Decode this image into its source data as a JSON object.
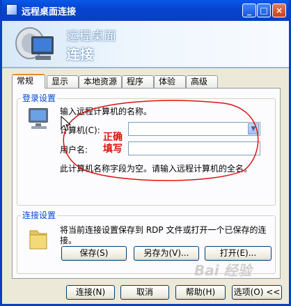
{
  "window": {
    "title": "远程桌面连接"
  },
  "banner": {
    "line1": "远程桌面",
    "line2": "连接"
  },
  "tabs": [
    "常规",
    "显示",
    "本地资源",
    "程序",
    "体验",
    "高级"
  ],
  "login": {
    "group_label": "登录设置",
    "instruction": "输入远程计算机的名称。",
    "computer_label": "计算机(C):",
    "computer_value": "",
    "username_label": "用户名:",
    "username_value": "",
    "note": "此计算机名称字段为空。请输入远程计算机的全名。"
  },
  "connection": {
    "group_label": "连接设置",
    "description_line1": "将当前连接设置保存到 RDP 文件或打开一个已保存的连",
    "description_line2": "接。",
    "save_label": "保存(S)",
    "save_as_label": "另存为(V)...",
    "open_label": "打开(E)..."
  },
  "footer": {
    "connect_label": "连接(N)",
    "cancel_label": "取消",
    "help_label": "帮助(H)",
    "options_label": "选项(O) <<"
  },
  "annotation": {
    "line1": "正确",
    "line2": "填写"
  },
  "watermark": "Bai 经验",
  "colors": {
    "titlebar": "#0a3fbf",
    "annotation": "#e01010",
    "tab_active_accent": "#e68b2c",
    "group_label": "#0046d5"
  }
}
